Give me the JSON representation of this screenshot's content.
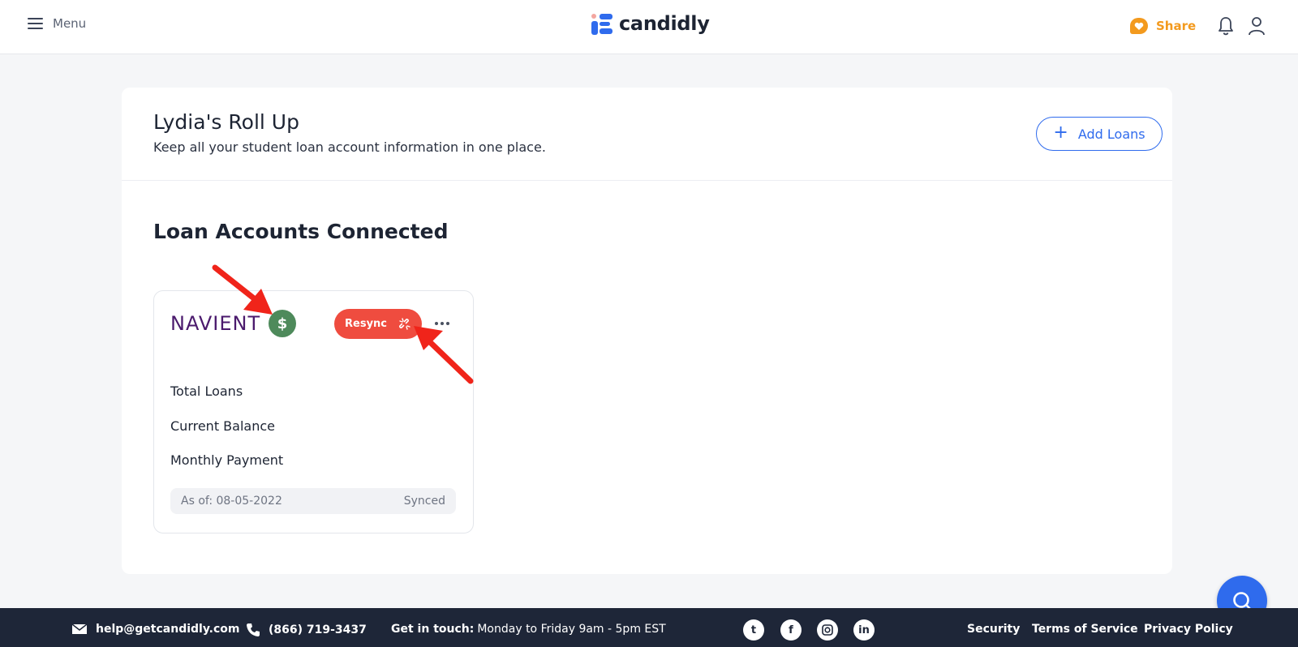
{
  "header": {
    "menu_label": "Menu",
    "logo_text": "candidly",
    "share_label": "Share"
  },
  "colors": {
    "brand_blue": "#2f6bed",
    "share_orange": "#f39a1e",
    "resync_red": "#ef4c3f",
    "badge_green": "#4e8a5b",
    "footer_navy": "#1e2638"
  },
  "page": {
    "title": "Lydia's Roll Up",
    "subtitle": "Keep all your student loan account information in one place.",
    "add_loans_label": "Add Loans",
    "section_title": "Loan Accounts Connected"
  },
  "loan_card": {
    "servicer": "NAVIENT",
    "badge_symbol": "$",
    "resync_label": "Resync",
    "rows": [
      "Total Loans",
      "Current Balance",
      "Monthly Payment"
    ],
    "as_of": "As of: 08-05-2022",
    "status": "Synced"
  },
  "footer": {
    "email": "help@getcandidly.com",
    "phone": "(866) 719-3437",
    "contact_label": "Get in touch:",
    "contact_hours": "Monday to Friday 9am - 5pm EST",
    "social": [
      "twitter",
      "facebook",
      "instagram",
      "linkedin"
    ],
    "links": [
      "Security",
      "Terms of Service",
      "Privacy Policy"
    ]
  }
}
